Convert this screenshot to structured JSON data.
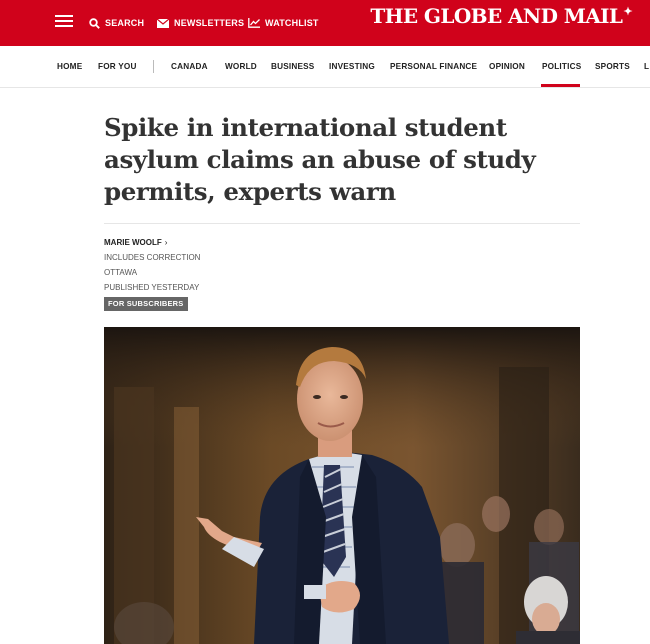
{
  "topbar": {
    "search_label": "SEARCH",
    "newsletters_label": "NEWSLETTERS",
    "watchlist_label": "WATCHLIST",
    "brand": "THE GLOBE AND MAIL",
    "brand_mark": "✦",
    "color": "#d0021b"
  },
  "nav": {
    "home": "HOME",
    "for_you": "FOR YOU",
    "canada": "CANADA",
    "world": "WORLD",
    "business": "BUSINESS",
    "investing": "INVESTING",
    "personal_finance": "PERSONAL FINANCE",
    "opinion": "OPINION",
    "politics": "POLITICS",
    "sports": "SPORTS",
    "overflow": "L",
    "active": "POLITICS"
  },
  "article": {
    "headline": "Spike in international student asylum claims an abuse of study permits, experts warn",
    "author": "MARIE WOOLF",
    "correction": "INCLUDES CORRECTION",
    "dateline": "OTTAWA",
    "published": "PUBLISHED YESTERDAY",
    "badge": "FOR SUBSCRIBERS"
  }
}
